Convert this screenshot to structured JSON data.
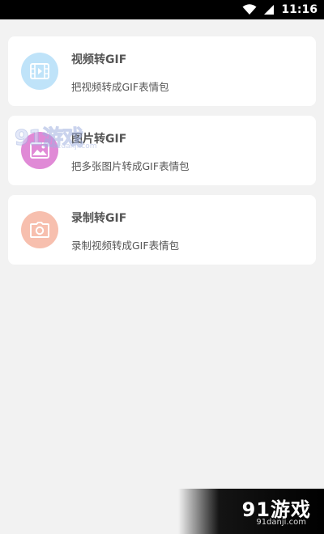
{
  "status_bar": {
    "time": "11:16",
    "icons": [
      "wifi-icon",
      "signal-icon"
    ]
  },
  "cards": [
    {
      "title": "视频转GIF",
      "subtitle": "把视频转成GIF表情包",
      "icon": "video-film-icon",
      "icon_color": "#bfe3f9"
    },
    {
      "title": "图片转GIF",
      "subtitle": "把多张图片转成GIF表情包",
      "icon": "image-picture-icon",
      "icon_color": "#e08ad6"
    },
    {
      "title": "录制转GIF",
      "subtitle": "录制视频转成GIF表情包",
      "icon": "camera-icon",
      "icon_color": "#f7bfae"
    }
  ],
  "watermarks": {
    "top_brand": "91游戏",
    "top_url": "91danji.com",
    "bottom_brand": "91游戏",
    "bottom_url": "91danji.com"
  }
}
